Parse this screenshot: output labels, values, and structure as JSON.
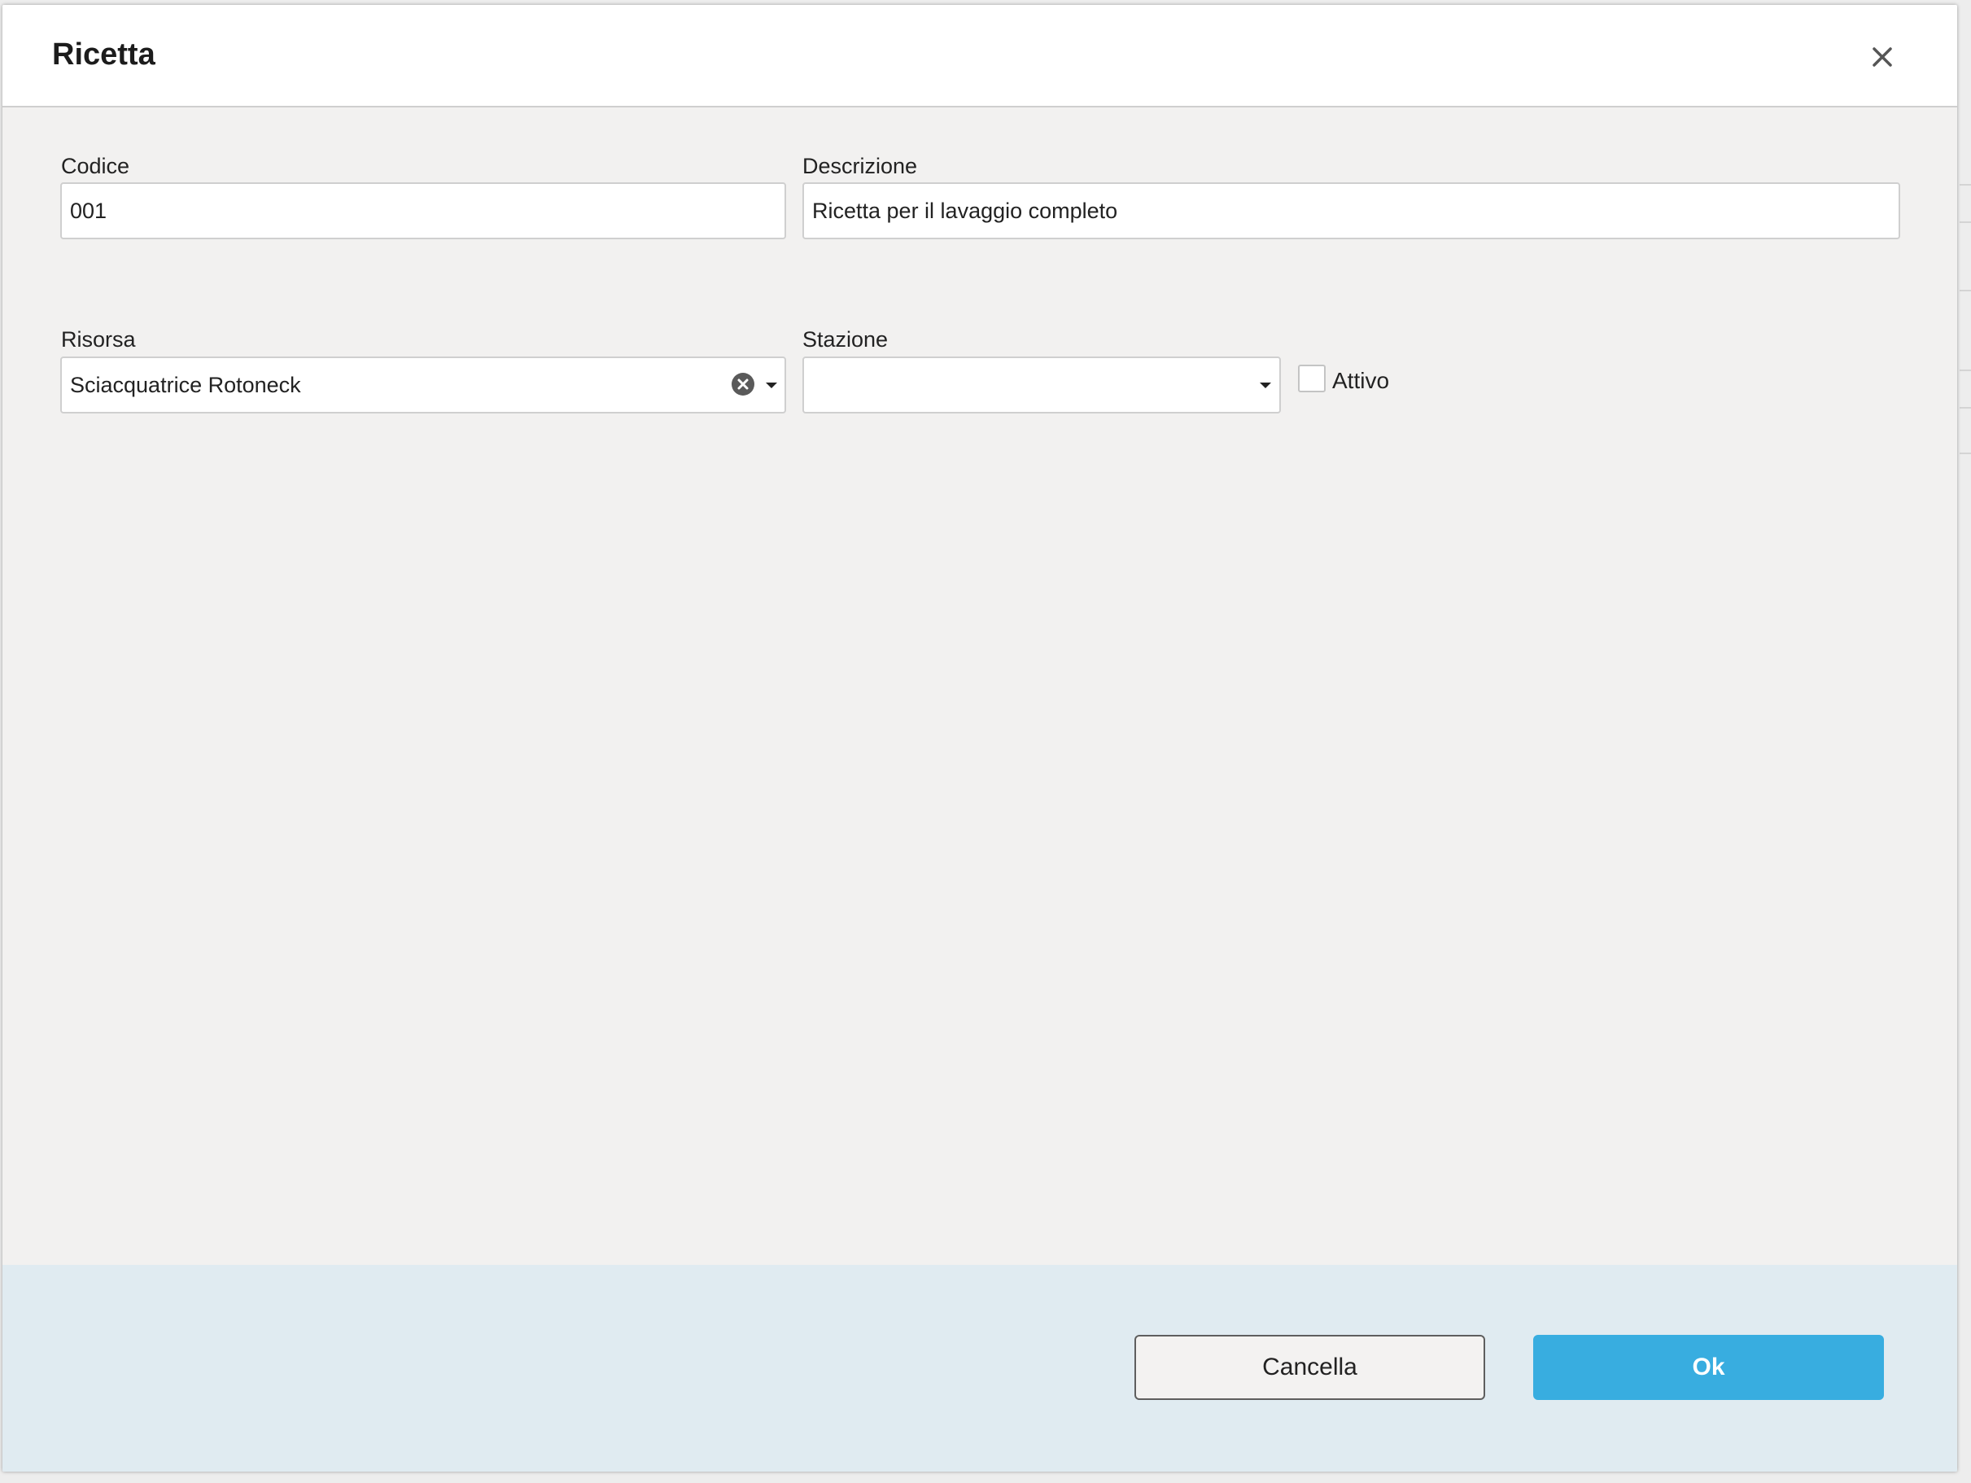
{
  "dialog": {
    "title": "Ricetta",
    "close_icon": "close-icon"
  },
  "form": {
    "codice": {
      "label": "Codice",
      "value": "001"
    },
    "descrizione": {
      "label": "Descrizione",
      "value": "Ricetta per il lavaggio completo"
    },
    "risorsa": {
      "label": "Risorsa",
      "value": "Sciacquatrice Rotoneck",
      "clear_icon": "clear-circle-icon",
      "dropdown_icon": "caret-down-icon"
    },
    "stazione": {
      "label": "Stazione",
      "value": "",
      "dropdown_icon": "caret-down-icon"
    },
    "attivo": {
      "label": "Attivo",
      "checked": false
    }
  },
  "footer": {
    "cancel_label": "Cancella",
    "ok_label": "Ok"
  },
  "colors": {
    "primary": "#38ade0",
    "footer_bg": "#e0ebf1",
    "body_bg": "#f2f1f0"
  }
}
